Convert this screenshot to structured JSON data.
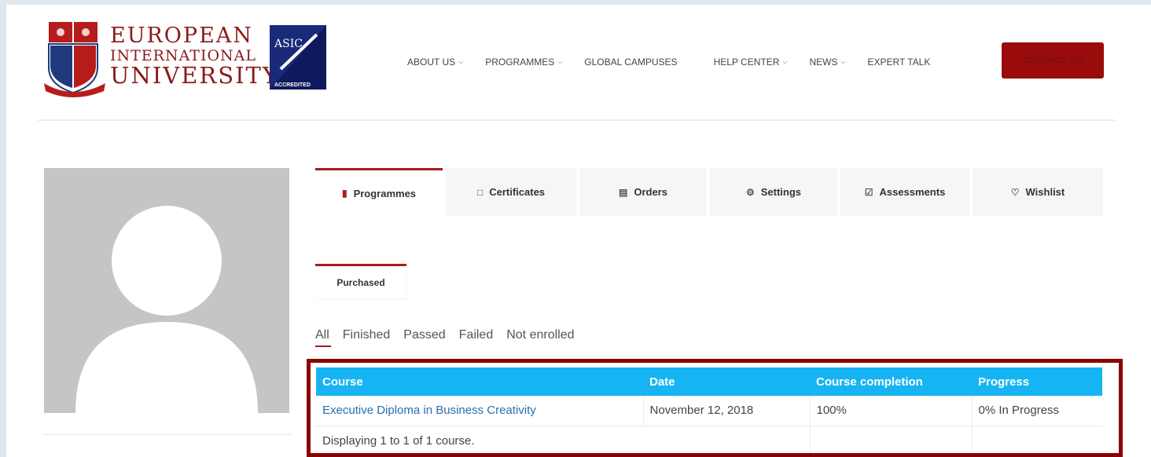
{
  "header": {
    "logo": {
      "line1": "EUROPEAN",
      "line2": "INTERNATIONAL",
      "line3": "UNIVERSITY",
      "badge_top": "ASIC",
      "badge_bottom": "ACCREDITED"
    },
    "nav": [
      {
        "label": "ABOUT US",
        "dropdown": true
      },
      {
        "label": "PROGRAMMES",
        "dropdown": true
      },
      {
        "label": "GLOBAL CAMPUSES",
        "dropdown": false
      },
      {
        "label": "HELP CENTER",
        "dropdown": true
      },
      {
        "label": "NEWS",
        "dropdown": true
      },
      {
        "label": "EXPERT TALK",
        "dropdown": false
      }
    ],
    "contact_label": "CONTACT US"
  },
  "profile_tabs": [
    {
      "label": "Programmes",
      "icon": "book-icon",
      "active": true
    },
    {
      "label": "Certificates",
      "icon": "bookmark-icon",
      "active": false
    },
    {
      "label": "Orders",
      "icon": "cart-icon",
      "active": false
    },
    {
      "label": "Settings",
      "icon": "gear-icon",
      "active": false
    },
    {
      "label": "Assessments",
      "icon": "checkbox-icon",
      "active": false
    },
    {
      "label": "Wishlist",
      "icon": "heart-icon",
      "active": false
    }
  ],
  "subtab": {
    "label": "Purchased"
  },
  "filters": [
    {
      "label": "All",
      "active": true
    },
    {
      "label": "Finished",
      "active": false
    },
    {
      "label": "Passed",
      "active": false
    },
    {
      "label": "Failed",
      "active": false
    },
    {
      "label": "Not enrolled",
      "active": false
    }
  ],
  "table": {
    "columns": [
      "Course",
      "Date",
      "Course completion",
      "Progress"
    ],
    "rows": [
      {
        "course": "Executive Diploma in Business Creativity",
        "date": "November 12, 2018",
        "completion": "100%",
        "progress": "0% In Progress"
      }
    ],
    "footer": "Displaying 1 to 1 of 1 course."
  },
  "colors": {
    "brand_red": "#8b1a1a",
    "tab_accent": "#a51c1c",
    "table_header": "#16b4f2",
    "link": "#2a6fb0"
  }
}
